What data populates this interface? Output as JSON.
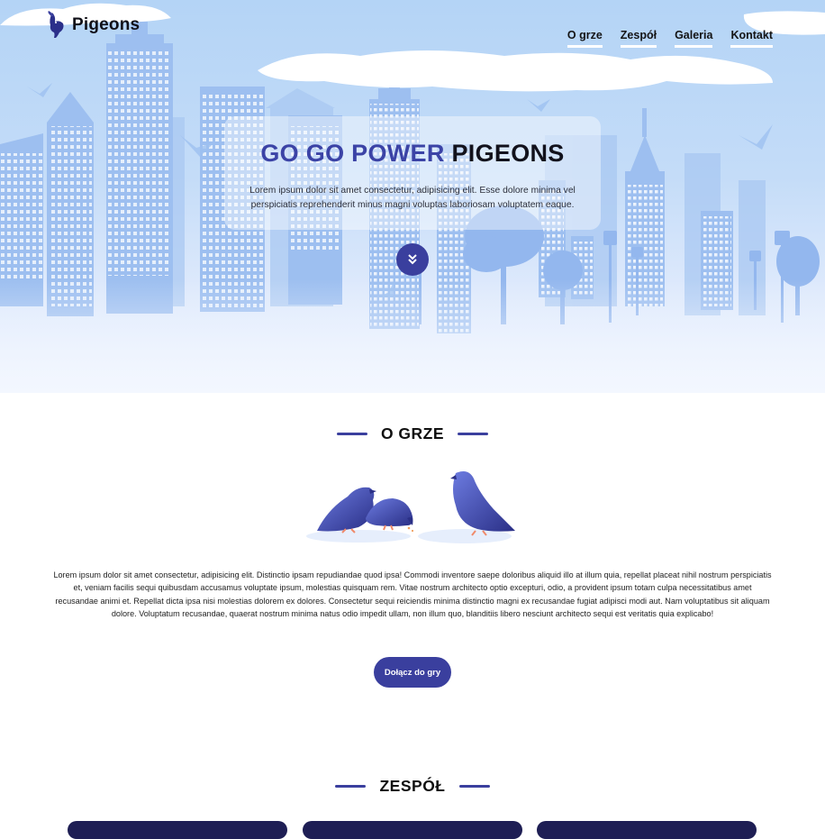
{
  "brand": {
    "name": "Pigeons",
    "logo_icon": "pigeon-icon"
  },
  "nav": {
    "items": [
      {
        "label": "O grze"
      },
      {
        "label": "Zespół"
      },
      {
        "label": "Galeria"
      },
      {
        "label": "Kontakt"
      }
    ]
  },
  "hero": {
    "title_part1": "GO GO POWER",
    "title_part2": "PIGEONS",
    "text": "Lorem ipsum dolor sit amet consectetur, adipisicing elit. Esse dolore minima vel perspiciatis reprehenderit minus magni voluptas laboriosam voluptatem eaque.",
    "scroll_icon": "double-chevron-down-icon"
  },
  "about": {
    "title": "O GRZE",
    "text": "Lorem ipsum dolor sit amet consectetur, adipisicing elit. Distinctio ipsam repudiandae quod ipsa! Commodi inventore saepe doloribus aliquid illo at illum quia, repellat placeat nihil nostrum perspiciatis et, veniam facilis sequi quibusdam accusamus voluptate ipsum, molestias quisquam rem. Vitae nostrum architecto optio excepturi, odio, a provident ipsum totam culpa necessitatibus amet recusandae animi et. Repellat dicta ipsa nisi molestias dolorem ex dolores. Consectetur sequi reiciendis minima distinctio magni ex recusandae fugiat adipisci modi aut. Nam voluptatibus sit aliquam dolore. Voluptatum recusandae, quaerat nostrum minima natus odio impedit ullam, non illum quo, blanditiis libero nesciunt architecto sequi est veritatis quia explicabo!",
    "button_label": "Dołącz do gry"
  },
  "team": {
    "title": "ZESPÓŁ"
  },
  "colors": {
    "accent": "#3a3f9e",
    "hero_title": "#3b43a6",
    "dark": "#12121c",
    "sky": "#b4d4f6"
  }
}
